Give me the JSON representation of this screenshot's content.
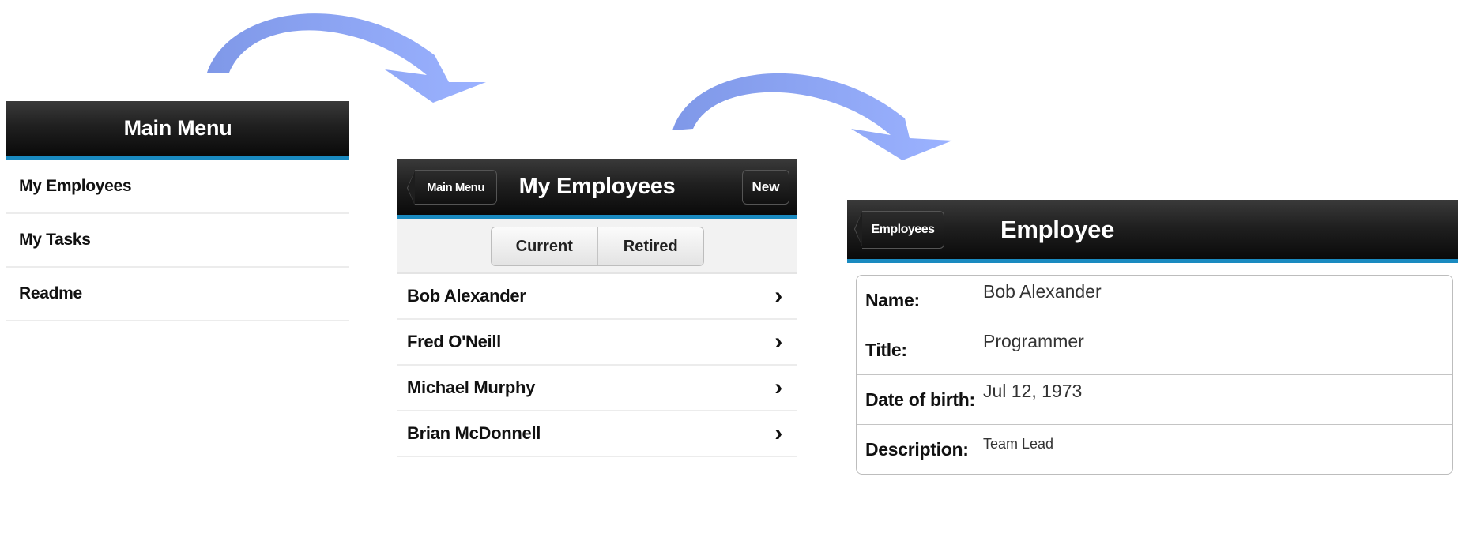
{
  "main_menu": {
    "title": "Main Menu",
    "items": [
      {
        "label": "My Employees"
      },
      {
        "label": "My Tasks"
      },
      {
        "label": "Readme"
      }
    ]
  },
  "employees_list": {
    "back_label": "Main Menu",
    "title": "My Employees",
    "new_label": "New",
    "segments": [
      {
        "label": "Current",
        "selected": true
      },
      {
        "label": "Retired",
        "selected": false
      }
    ],
    "items": [
      {
        "name": "Bob Alexander"
      },
      {
        "name": "Fred O'Neill"
      },
      {
        "name": "Michael Murphy"
      },
      {
        "name": "Brian McDonnell"
      }
    ],
    "chevron": "›"
  },
  "employee_detail": {
    "back_label": "Employees",
    "title": "Employee",
    "fields": [
      {
        "label": "Name:",
        "value": "Bob Alexander"
      },
      {
        "label": "Title:",
        "value": "Programmer"
      },
      {
        "label": "Date of birth:",
        "value": "Jul 12, 1973"
      },
      {
        "label": "Description:",
        "value": "Team Lead"
      }
    ]
  },
  "theme": {
    "accent": "#1a8ac0",
    "navbar": "#1a1a1a",
    "arrow": "#8fa8f0"
  },
  "icons": [
    "curved-arrow-icon",
    "back-arrow-icon",
    "chevron-right-icon"
  ]
}
